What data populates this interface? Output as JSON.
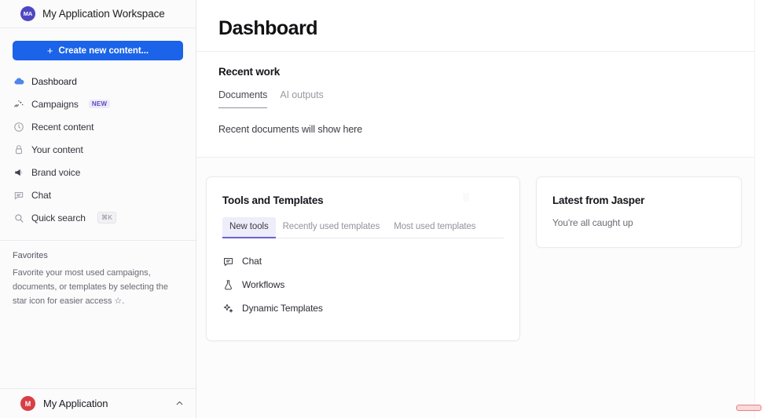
{
  "sidebar": {
    "workspace": {
      "avatar_initials": "MA",
      "avatar_color": "#4e47c2",
      "title": "My Application Workspace"
    },
    "create_button": {
      "label": "Create new content...",
      "plus_glyph": "+",
      "color": "#1b63e8"
    },
    "nav_items": [
      {
        "label": "Dashboard",
        "icon": "cloud-icon",
        "badge": "",
        "kbd": ""
      },
      {
        "label": "Campaigns",
        "icon": "campaigns-icon",
        "badge": "NEW",
        "kbd": ""
      },
      {
        "label": "Recent content",
        "icon": "clock-icon",
        "badge": "",
        "kbd": ""
      },
      {
        "label": "Your content",
        "icon": "user-lock-icon",
        "badge": "",
        "kbd": ""
      },
      {
        "label": "Brand voice",
        "icon": "megaphone-icon",
        "badge": "",
        "kbd": ""
      },
      {
        "label": "Chat",
        "icon": "chat-icon",
        "badge": "",
        "kbd": ""
      },
      {
        "label": "Quick search",
        "icon": "search-icon",
        "badge": "",
        "kbd": "⌘K"
      }
    ],
    "favorites": {
      "title": "Favorites",
      "description": "Favorite your most used campaigns, documents, or templates by selecting the star icon for easier access ☆."
    },
    "footer": {
      "avatar_initials": "M",
      "avatar_color": "#d83f45",
      "name": "My Application",
      "chevron": "chevron-up-icon"
    }
  },
  "main": {
    "page_title": "Dashboard",
    "recent_work": {
      "title": "Recent work",
      "tabs": [
        {
          "label": "Documents",
          "active": true
        },
        {
          "label": "AI outputs",
          "active": false
        }
      ],
      "empty_text": "Recent documents will show here"
    },
    "tools_card": {
      "title": "Tools and Templates",
      "tabs": [
        {
          "label": "New tools",
          "active": true
        },
        {
          "label": "Recently used templates",
          "active": false
        },
        {
          "label": "Most used templates",
          "active": false
        }
      ],
      "items": [
        {
          "label": "Chat",
          "icon": "chat-bubble-icon"
        },
        {
          "label": "Workflows",
          "icon": "flask-icon"
        },
        {
          "label": "Dynamic Templates",
          "icon": "sparkles-icon"
        }
      ]
    },
    "jasper_card": {
      "title": "Latest from Jasper",
      "empty_text": "You're all caught up"
    }
  }
}
